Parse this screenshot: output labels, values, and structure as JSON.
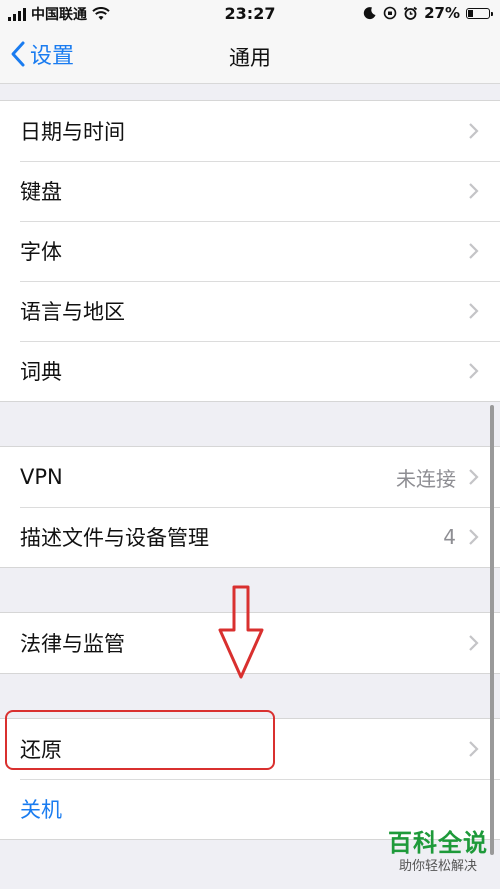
{
  "status_bar": {
    "carrier": "中国联通",
    "time": "23:27",
    "battery_percent_label": "27%",
    "battery_level": 0.27
  },
  "nav": {
    "back_label": "设置",
    "title": "通用"
  },
  "groups": [
    {
      "items": [
        {
          "label": "日期与时间"
        },
        {
          "label": "键盘"
        },
        {
          "label": "字体"
        },
        {
          "label": "语言与地区"
        },
        {
          "label": "词典"
        }
      ]
    },
    {
      "items": [
        {
          "label": "VPN",
          "value": "未连接"
        },
        {
          "label": "描述文件与设备管理",
          "value": "4"
        }
      ]
    },
    {
      "items": [
        {
          "label": "法律与监管"
        }
      ]
    },
    {
      "items": [
        {
          "label": "还原"
        },
        {
          "label": "关机"
        }
      ]
    }
  ],
  "watermark": {
    "main": "百科全说",
    "sub": "助你轻松解决"
  },
  "colors": {
    "accent": "#1a7cf0",
    "annotation": "#d9302f",
    "background": "#efeff4"
  }
}
